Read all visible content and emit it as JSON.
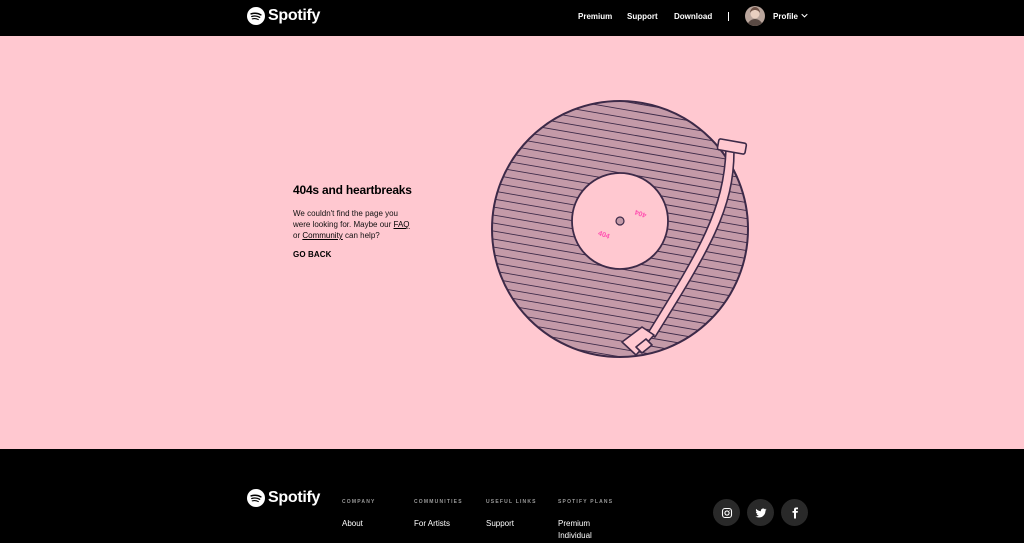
{
  "brand": {
    "name": "Spotify"
  },
  "nav": {
    "premium": "Premium",
    "support": "Support",
    "download": "Download",
    "profile": "Profile"
  },
  "error": {
    "title": "404s and heartbreaks",
    "message_1": "We couldn't find the page you were looking for. Maybe our ",
    "faq_link": "FAQ",
    "message_2": " or ",
    "community_link": "Community",
    "message_3": " can help?",
    "go_back": "GO BACK",
    "record_label_text": "404"
  },
  "footer": {
    "columns": [
      {
        "heading": "COMPANY",
        "items": [
          "About"
        ]
      },
      {
        "heading": "COMMUNITIES",
        "items": [
          "For Artists"
        ]
      },
      {
        "heading": "USEFUL LINKS",
        "items": [
          "Support"
        ]
      },
      {
        "heading": "SPOTIFY PLANS",
        "items": [
          "Premium Individual"
        ]
      }
    ],
    "social": [
      "instagram-icon",
      "twitter-icon",
      "facebook-icon"
    ]
  },
  "colors": {
    "background_main": "#ffc8d0",
    "record": "#c49aa8",
    "record_stroke": "#3d2a48",
    "label_text": "#ff4fb0",
    "header_footer": "#000000"
  }
}
